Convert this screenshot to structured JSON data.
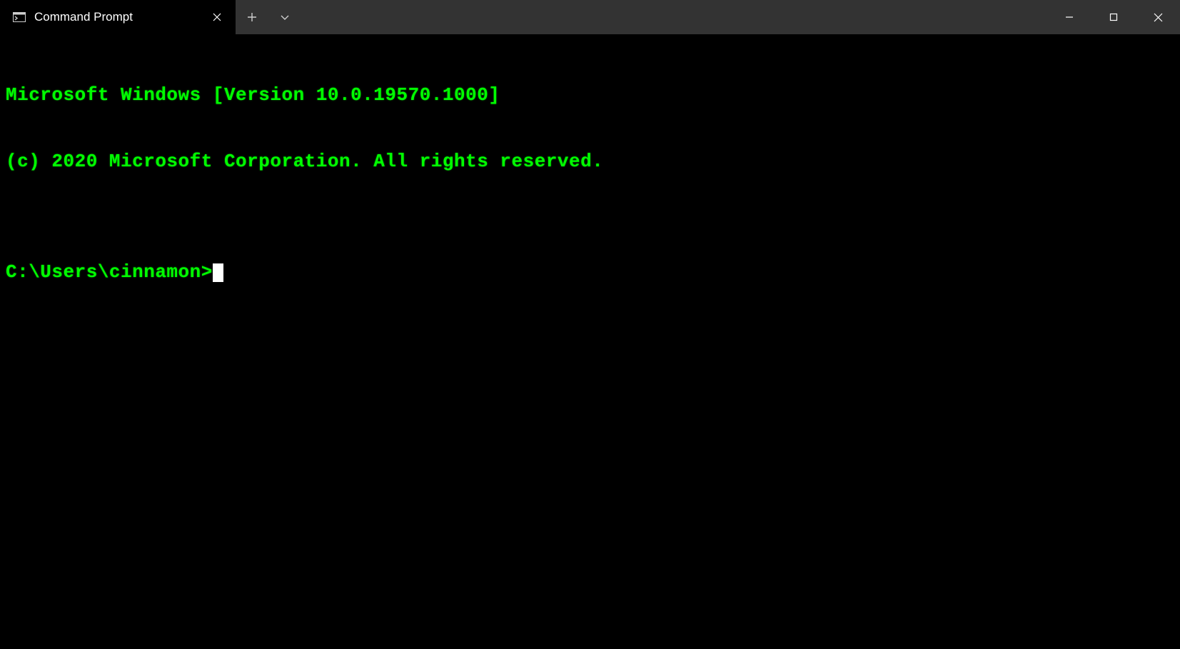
{
  "titlebar": {
    "tab": {
      "title": "Command Prompt"
    }
  },
  "terminal": {
    "banner_line1": "Microsoft Windows [Version 10.0.19570.1000]",
    "banner_line2": "(c) 2020 Microsoft Corporation. All rights reserved.",
    "blank": "",
    "prompt": "C:\\Users\\cinnamon>"
  },
  "colors": {
    "terminal_fg": "#00ff00",
    "terminal_bg": "#000000",
    "titlebar_bg": "#333333",
    "tab_active_bg": "#000000",
    "cursor": "#ffffff"
  }
}
